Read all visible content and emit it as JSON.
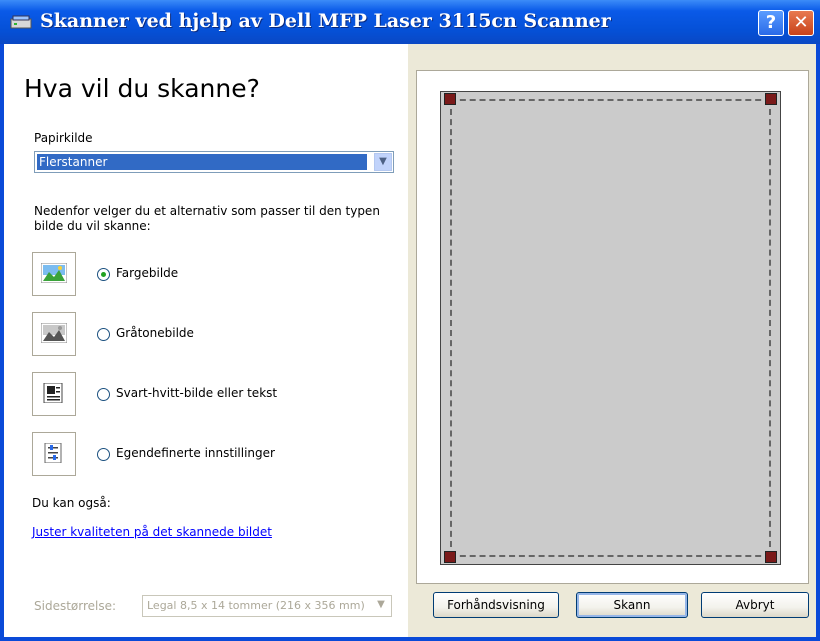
{
  "window": {
    "title": "Skanner ved hjelp av Dell MFP Laser 3115cn Scanner",
    "help_label": "?",
    "close_label": "✕"
  },
  "left": {
    "heading": "Hva vil du skanne?",
    "paper_source_label": "Papirkilde",
    "paper_source_value": "Flerstanner",
    "description": "Nedenfor velger du et alternativ som passer til den typen bilde du vil skanne:",
    "options": [
      {
        "label": "Fargebilde",
        "icon": "color-picture-icon",
        "checked": true
      },
      {
        "label": "Gråtonebilde",
        "icon": "grayscale-picture-icon",
        "checked": false
      },
      {
        "label": "Svart-hvitt-bilde eller tekst",
        "icon": "black-white-text-icon",
        "checked": false
      },
      {
        "label": "Egendefinerte innstillinger",
        "icon": "custom-settings-icon",
        "checked": false
      }
    ],
    "also_label": "Du kan også:",
    "adjust_link": "Juster kvaliteten på det skannede bildet",
    "page_size_label": "Sidestørrelse:",
    "page_size_value": "Legal 8,5 x 14 tommer (216 x 356 mm)"
  },
  "buttons": {
    "preview": "Forhåndsvisning",
    "scan": "Skann",
    "cancel": "Avbryt"
  },
  "colors": {
    "titlebar": "#0a5ae8",
    "selection": "#316ac5",
    "link": "#0000ff",
    "preview_paper": "#cbcbcb",
    "radio_dot": "#21a121"
  }
}
